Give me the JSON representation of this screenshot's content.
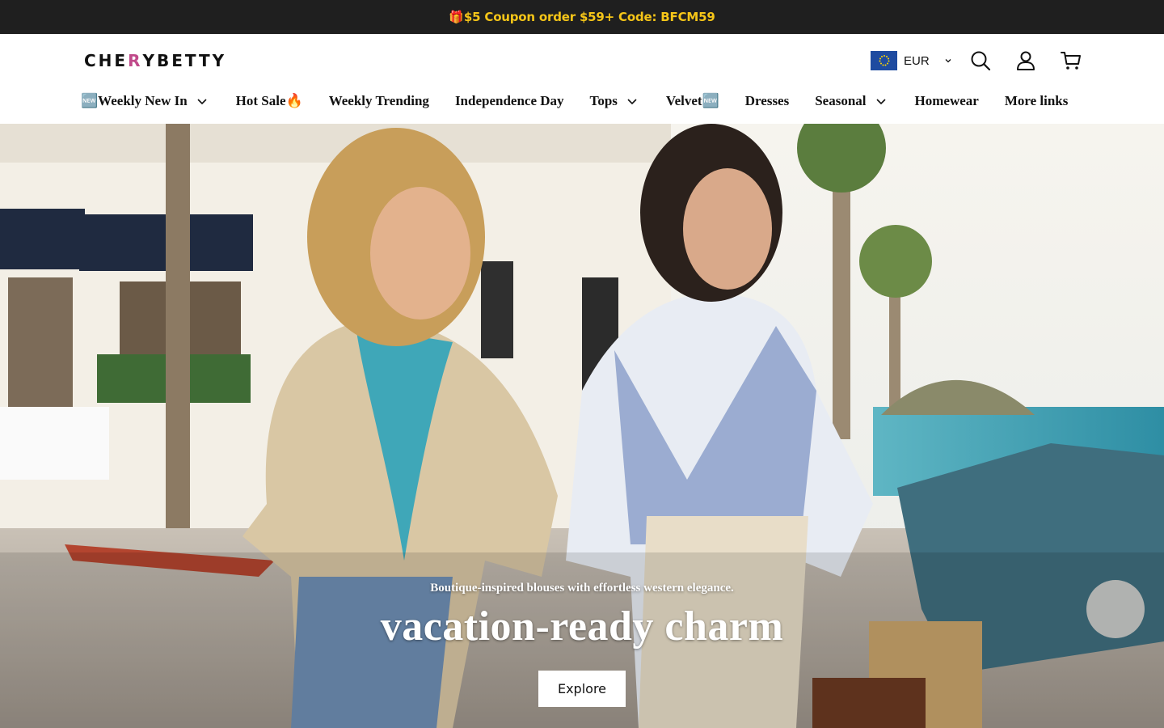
{
  "announcement": {
    "text": "🎁$5 Coupon order $59+ Code: BFCM59"
  },
  "brand": {
    "name_prefix": "CHE",
    "name_mark": "R",
    "name_suffix": "YBETTY"
  },
  "currency": {
    "code": "EUR",
    "flag_icon": "eu-flag-icon"
  },
  "header_icons": [
    "search-icon",
    "account-icon",
    "cart-icon"
  ],
  "nav": {
    "items": [
      {
        "label": "🆕Weekly New In",
        "dropdown": true
      },
      {
        "label": "Hot Sale🔥",
        "dropdown": false
      },
      {
        "label": "Weekly Trending",
        "dropdown": false
      },
      {
        "label": "Independence Day",
        "dropdown": false
      },
      {
        "label": "Tops",
        "dropdown": true
      },
      {
        "label": "Velvet🆕",
        "dropdown": false
      },
      {
        "label": "Dresses",
        "dropdown": false
      },
      {
        "label": "Seasonal",
        "dropdown": true
      },
      {
        "label": "Homewear",
        "dropdown": false
      },
      {
        "label": "More links",
        "dropdown": false
      }
    ]
  },
  "hero": {
    "subtitle": "Boutique-inspired blouses with effortless western elegance.",
    "title": "vacation-ready charm",
    "cta": "Explore"
  },
  "colors": {
    "announce_bg": "#1f1f1f",
    "announce_text": "#f5c518",
    "brand_mark": "#c04a8a",
    "flag_blue": "#1e4ba0"
  }
}
